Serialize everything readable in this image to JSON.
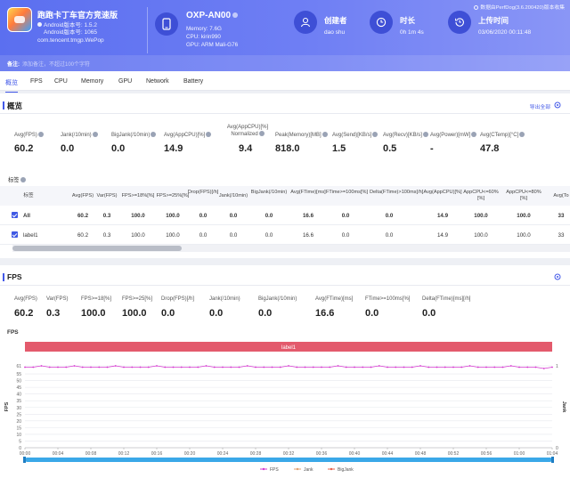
{
  "header": {
    "app": {
      "name": "跑跑卡丁车官方竞速版",
      "android_version": "Android版本号: 1.5.2",
      "android_code": "Android版本号: 1065",
      "package": "com.tencent.tmgp.WePop"
    },
    "device": {
      "name": "OXP-AN00",
      "memory": "Memory: 7.6G",
      "cpu": "CPU: kirin990",
      "gpu": "GPU: ARM Mali-G76"
    },
    "creator": {
      "label": "创建者",
      "value": "dao shu"
    },
    "duration": {
      "label": "时长",
      "value": "0h 1m 4s"
    },
    "upload": {
      "label": "上传时间",
      "value": "03/06/2020 00:11:48"
    },
    "note": "数据由PerfDog(3.6.200420)版本收集",
    "remark": {
      "label": "备注:",
      "placeholder": "添加备注，不超过100个字符"
    }
  },
  "tabs": [
    "概览",
    "FPS",
    "CPU",
    "Memory",
    "GPU",
    "Network",
    "Battery"
  ],
  "overview": {
    "title": "概览",
    "export_label": "导出全部",
    "metrics": [
      {
        "label": "Avg(FPS)",
        "value": "60.2"
      },
      {
        "label": "Jank(/10min)",
        "value": "0.0"
      },
      {
        "label": "BigJank(/10min)",
        "value": "0.0"
      },
      {
        "label": "Avg(AppCPU)[%]",
        "value": "14.9"
      },
      {
        "label": "Avg(AppCPU)[%] Normalized",
        "value": "9.4"
      },
      {
        "label": "Peak(Memory)[MB]",
        "value": "818.0"
      },
      {
        "label": "Avg(Send)[KB/s]",
        "value": "1.5"
      },
      {
        "label": "Avg(Recv)[KB/s]",
        "value": "0.5"
      },
      {
        "label": "Avg(Power)[mW]",
        "value": "-"
      },
      {
        "label": "Avg(CTemp)[°C]",
        "value": "47.8"
      }
    ],
    "tag_label": "标签",
    "table": {
      "headers": [
        "标签",
        "Avg(FPS)",
        "Var(FPS)",
        "FPS>=18%[%]",
        "FPS>=25%[%]",
        "Drop(FPS)[/h]",
        "Jank(/10min)",
        "BigJank(/10min)",
        "Avg(FTime)[ms]",
        "FTime>=100ms[%]",
        "Delta(FTime)>100ms[/h]",
        "Avg(AppCPU)[%]",
        "AppCPU<=60%[%]",
        "AppCPU<=80%[%]",
        "Avg(To"
      ],
      "rows": [
        {
          "name": "All",
          "cells": [
            "60.2",
            "0.3",
            "100.0",
            "100.0",
            "0.0",
            "0.0",
            "0.0",
            "16.6",
            "0.0",
            "0.0",
            "14.9",
            "100.0",
            "100.0",
            "33"
          ]
        },
        {
          "name": "label1",
          "cells": [
            "60.2",
            "0.3",
            "100.0",
            "100.0",
            "0.0",
            "0.0",
            "0.0",
            "16.6",
            "0.0",
            "0.0",
            "14.9",
            "100.0",
            "100.0",
            "33"
          ]
        }
      ]
    }
  },
  "fps": {
    "title": "FPS",
    "metrics": [
      {
        "label": "Avg(FPS)",
        "value": "60.2"
      },
      {
        "label": "Var(FPS)",
        "value": "0.3"
      },
      {
        "label": "FPS>=18[%]",
        "value": "100.0"
      },
      {
        "label": "FPS>=25[%]",
        "value": "100.0"
      },
      {
        "label": "Drop(FPS)[/h]",
        "value": "0.0"
      },
      {
        "label": "Jank(/10min)",
        "value": "0.0"
      },
      {
        "label": "BigJank(/10min)",
        "value": "0.0"
      },
      {
        "label": "Avg(FTime)[ms]",
        "value": "16.6"
      },
      {
        "label": "FTime>=100ms[%]",
        "value": "0.0"
      },
      {
        "label": "Delta(FTime)[ms][/h]",
        "value": "0.0"
      }
    ]
  },
  "chart_data": {
    "type": "line",
    "title": "FPS",
    "ylabel": "FPS",
    "y2label": "Jank",
    "band_label": "label1",
    "ylim": [
      0,
      61
    ],
    "y_ticks": [
      61,
      55,
      50,
      45,
      40,
      35,
      30,
      25,
      20,
      15,
      10,
      5,
      0
    ],
    "y2_ticks": [
      1,
      0
    ],
    "x_ticks": [
      "00:00",
      "00:04",
      "00:08",
      "00:12",
      "00:16",
      "00:20",
      "00:24",
      "00:28",
      "00:32",
      "00:36",
      "00:40",
      "00:44",
      "00:48",
      "00:52",
      "00:56",
      "01:00",
      "01:04"
    ],
    "xlim_seconds": [
      0,
      64
    ],
    "grid": true,
    "legend_position": "bottom",
    "series": [
      {
        "name": "FPS",
        "color": "#d63ad0",
        "values": [
          60,
          60,
          61,
          60,
          60,
          60,
          61,
          60,
          60,
          60,
          60,
          61,
          60,
          60,
          60,
          60,
          61,
          60,
          60,
          60,
          60,
          60,
          61,
          60,
          60,
          60,
          60,
          61,
          60,
          60,
          60,
          60,
          61,
          60,
          60,
          60,
          60,
          60,
          61,
          60,
          60,
          60,
          60,
          61,
          60,
          60,
          60,
          60,
          61,
          60,
          60,
          60,
          60,
          60,
          61,
          60,
          60,
          60,
          60,
          61,
          60,
          60,
          60,
          59,
          60
        ]
      },
      {
        "name": "Jank",
        "color": "#e0a070",
        "values": []
      },
      {
        "name": "BigJank",
        "color": "#e8604a",
        "values": []
      }
    ]
  },
  "colors": {
    "accent": "#4258e8",
    "band": "#e35a6c",
    "slider": "#3aa8e8"
  }
}
